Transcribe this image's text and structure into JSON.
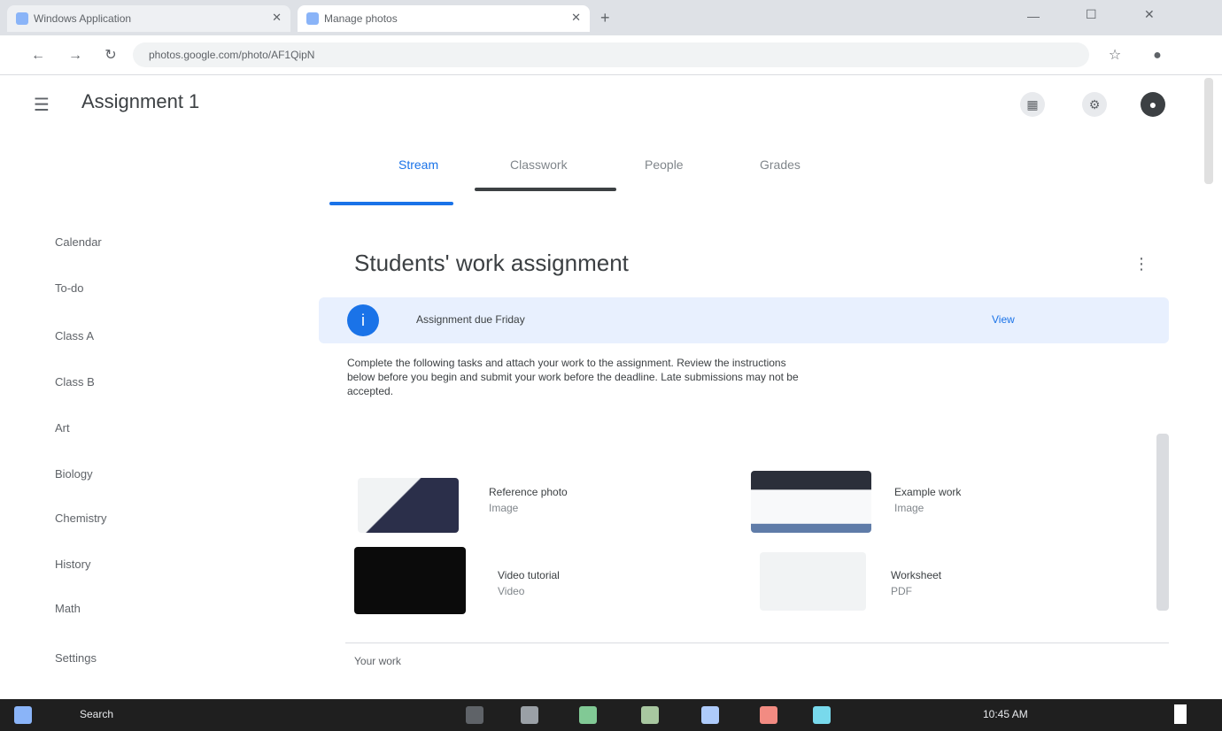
{
  "browser": {
    "tabs": [
      {
        "title": "Windows Application"
      },
      {
        "title": "Manage photos"
      }
    ],
    "address": "photos.google.com/photo/AF1QipN"
  },
  "app": {
    "title": "Assignment 1",
    "menu_icon": "menu-icon",
    "header_icons": [
      "apps-icon",
      "settings-icon",
      "account-icon"
    ]
  },
  "nav_tabs": [
    "Stream",
    "Classwork",
    "People",
    "Grades"
  ],
  "sidebar": {
    "items": [
      {
        "label": "Calendar"
      },
      {
        "label": "To-do"
      },
      {
        "label": "Class A"
      },
      {
        "label": "Class B"
      },
      {
        "label": "Art"
      },
      {
        "label": "Biology"
      },
      {
        "label": "Chemistry"
      },
      {
        "label": "History"
      },
      {
        "label": "Math"
      },
      {
        "label": "Settings"
      }
    ]
  },
  "main": {
    "page_title": "Students' work assignment",
    "banner_text": "Assignment due Friday",
    "banner_action": "View",
    "description": "Complete the following tasks and attach your work to the assignment. Review the instructions below before you begin and submit your work before the deadline. Late submissions may not be accepted.",
    "attachments": [
      {
        "title": "Reference photo",
        "subtitle": "Image"
      },
      {
        "title": "Example work",
        "subtitle": "Image"
      },
      {
        "title": "Video tutorial",
        "subtitle": "Video"
      },
      {
        "title": "Worksheet",
        "subtitle": "PDF"
      }
    ],
    "footer_label": "Your work"
  },
  "taskbar": {
    "search": "Search",
    "clock": "10:45 AM"
  },
  "colors": {
    "accent": "#1a73e8",
    "banner_bg": "#e8f0fe",
    "taskbar": "#1f1f1f"
  }
}
